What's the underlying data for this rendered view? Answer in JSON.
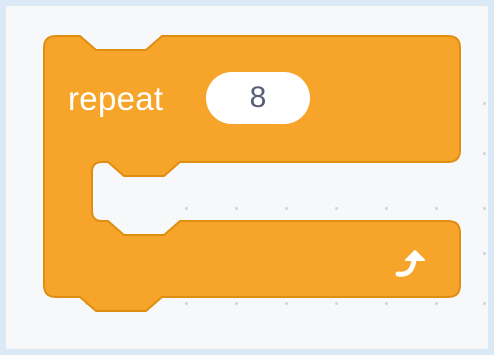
{
  "block": {
    "opcode_label": "repeat",
    "times_value": "8",
    "arrow_icon": "loop-arrow-icon"
  },
  "colors": {
    "block_fill": "#f7a52a",
    "block_stroke": "#e08e12",
    "workspace": "#f7f8fa",
    "border": "#dbe8f5",
    "input_text": "#575e75"
  }
}
